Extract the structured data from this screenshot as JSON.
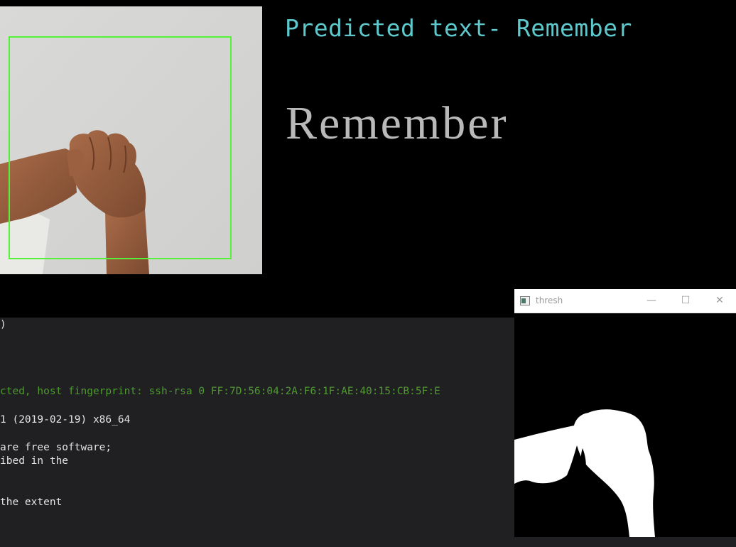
{
  "prediction": {
    "label": "Predicted text- Remember",
    "word": "Remember"
  },
  "camera": {
    "roi_box_color": "#55f23a"
  },
  "terminal": {
    "lines": [
      ")",
      "cted, host fingerprint: ssh-rsa 0 FF:7D:56:04:2A:F6:1F:AE:40:15:CB:5F:E",
      "1 (2019-02-19) x86_64",
      "are free software;",
      "ibed in the",
      "the extent"
    ],
    "highlight_color": "#4e9a2e"
  },
  "thresh_window": {
    "title": "thresh",
    "icons": {
      "app": "app-window-icon",
      "minimize": "minimize-icon",
      "maximize": "maximize-icon",
      "close": "close-icon"
    },
    "minimize_glyph": "—",
    "maximize_glyph": "☐",
    "close_glyph": "✕"
  }
}
